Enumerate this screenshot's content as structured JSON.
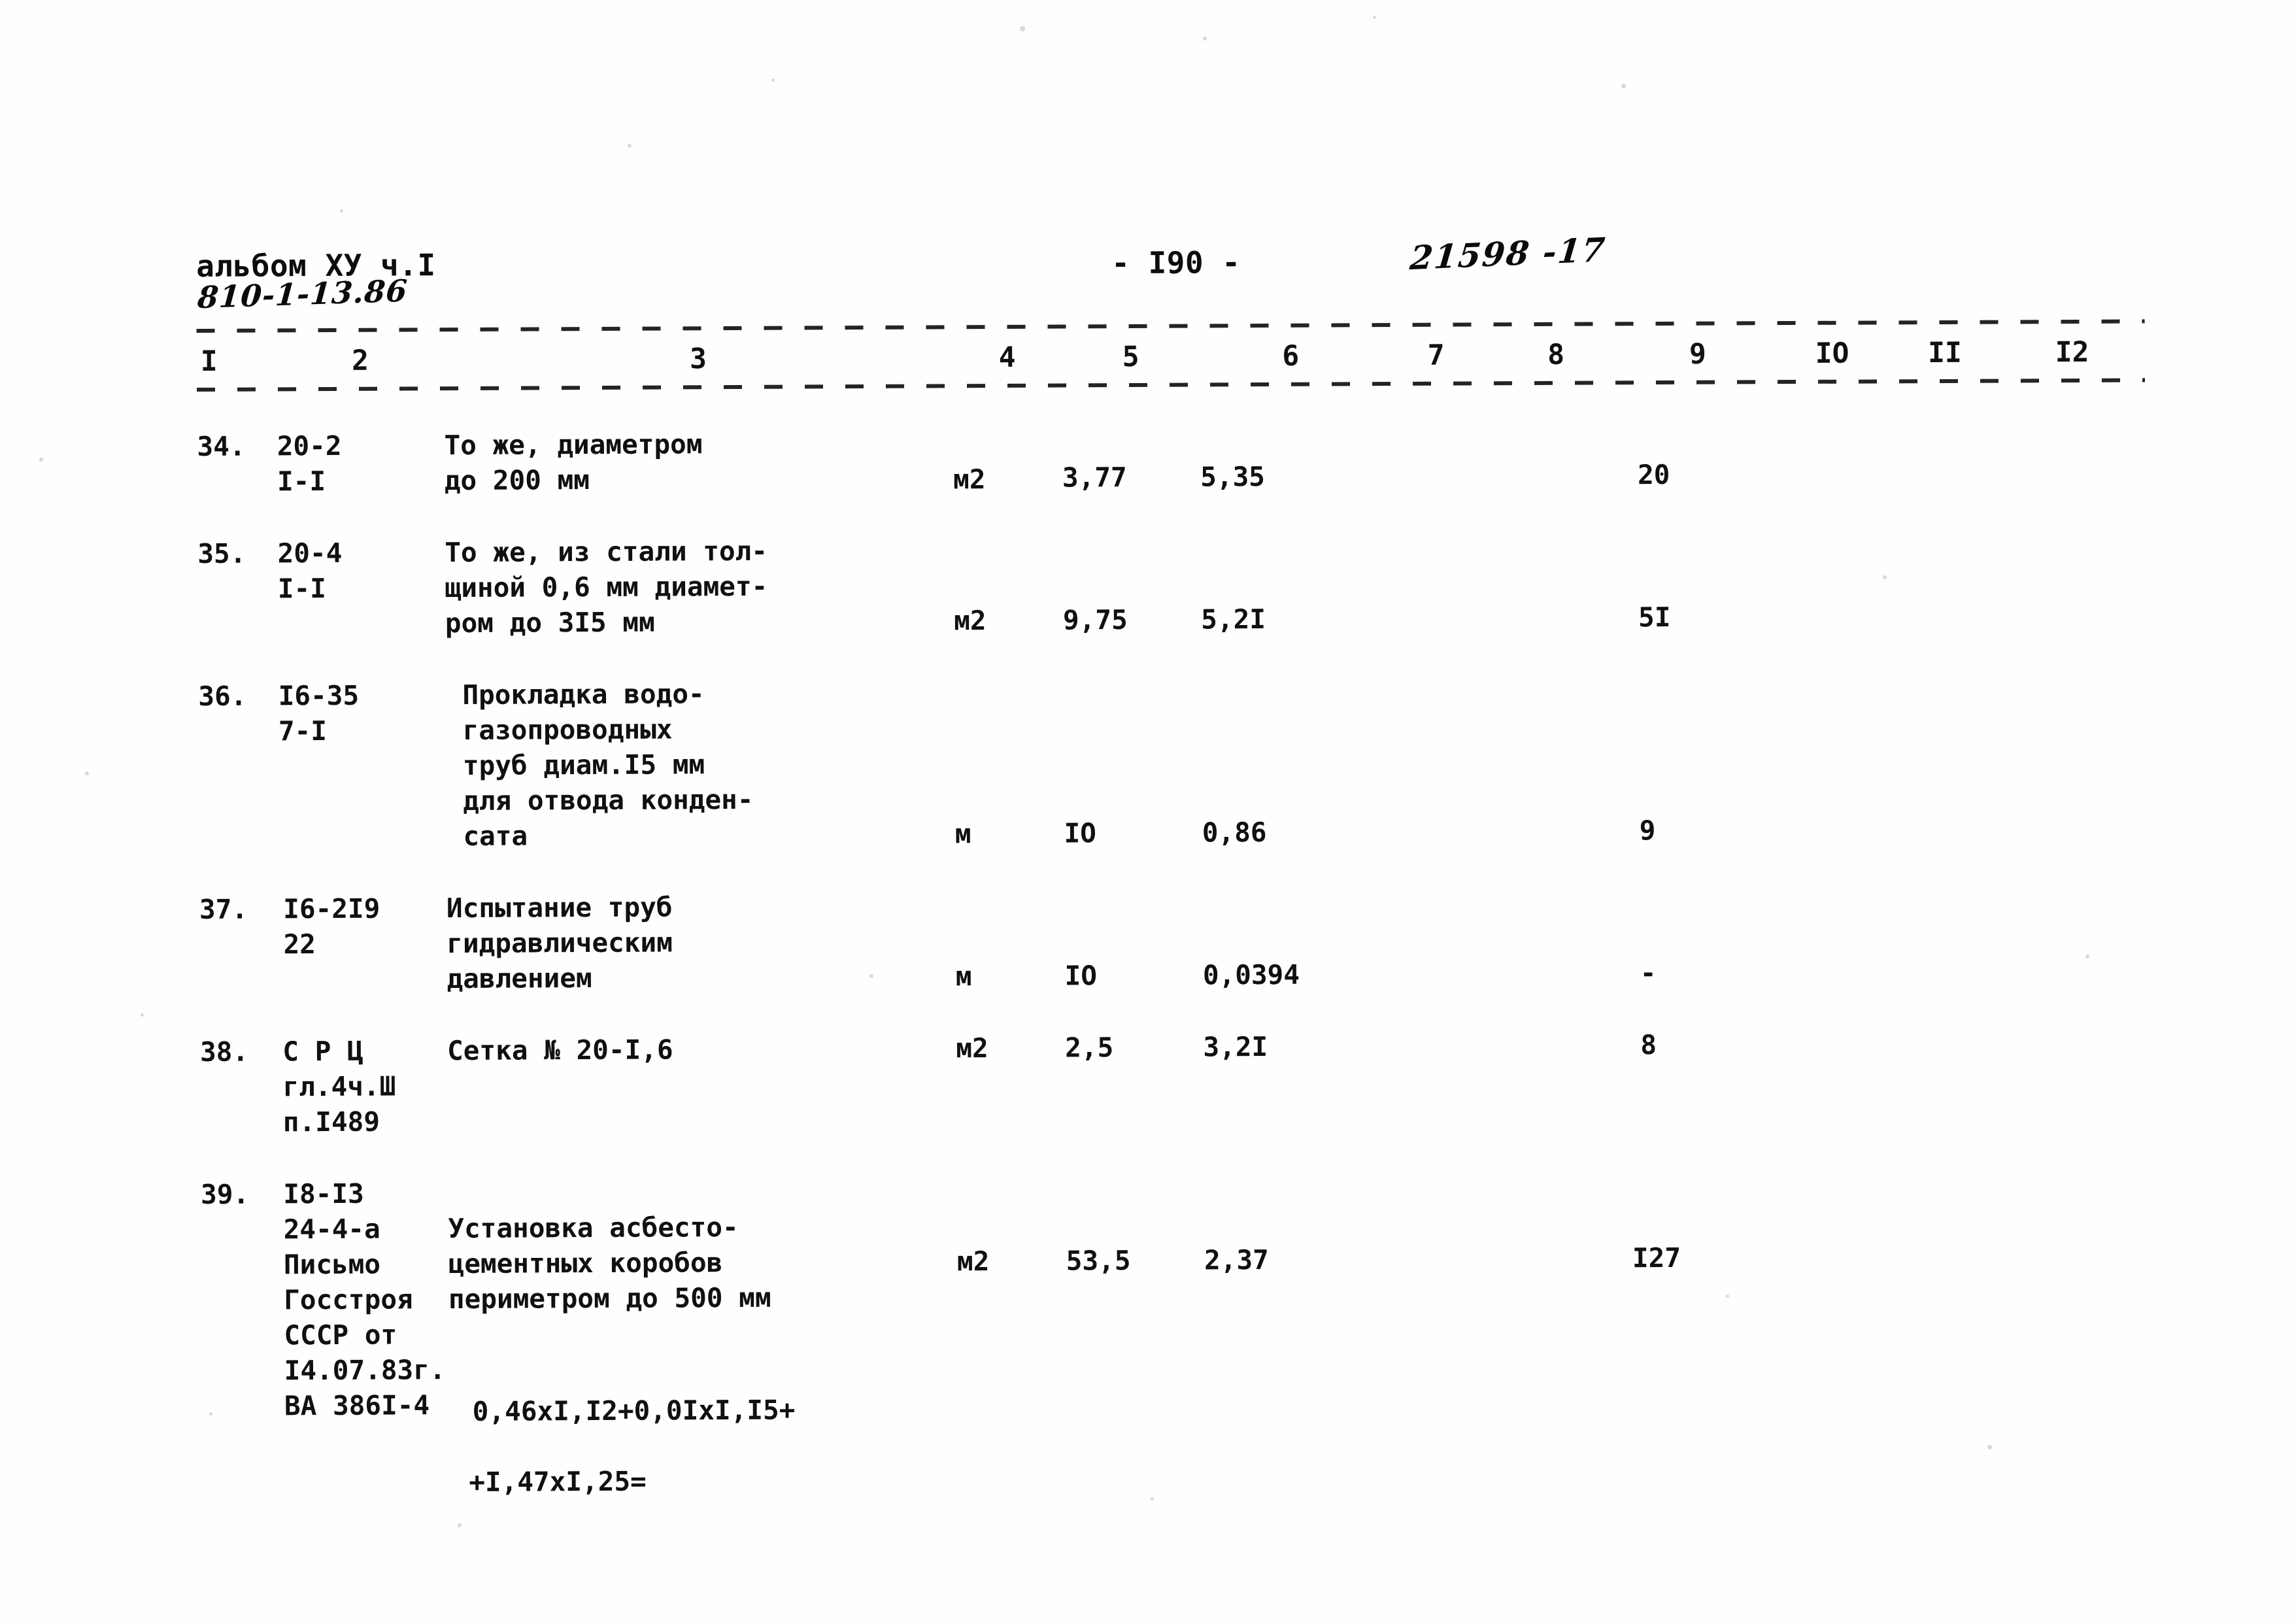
{
  "document": {
    "header": {
      "album_label": "альбом ХУ ч.I",
      "project_code": "810-1-13.86",
      "page_number": "- I90 -",
      "doc_number": "21598 -17"
    },
    "column_headers": [
      "I",
      "2",
      "3",
      "4",
      "5",
      "6",
      "7",
      "8",
      "9",
      "IO",
      "II",
      "I2"
    ],
    "rows": [
      {
        "index": "34.",
        "code": "20-2\nI-I",
        "description": "То же, диаметром\nдо 200 мм",
        "unit": "м2",
        "col5": "3,77",
        "col6": "5,35",
        "col7": "",
        "col8": "",
        "col9": "20",
        "col10": "",
        "col11": "",
        "col12": ""
      },
      {
        "index": "35.",
        "code": "20-4\nI-I",
        "description": "То же, из стали тол-\nщиной 0,6 мм диамет-\nром до 3I5 мм",
        "unit": "м2",
        "col5": "9,75",
        "col6": "5,2I",
        "col7": "",
        "col8": "",
        "col9": "5I",
        "col10": "",
        "col11": "",
        "col12": ""
      },
      {
        "index": "36.",
        "code": "I6-35\n7-I",
        "description": "Прокладка водо-\nгазопроводных\nтруб диам.I5  мм\nдля отвода конден-\nсата",
        "unit": "м",
        "col5": "IO",
        "col6": "0,86",
        "col7": "",
        "col8": "",
        "col9": "9",
        "col10": "",
        "col11": "",
        "col12": ""
      },
      {
        "index": "37.",
        "code": "I6-2I9\n22",
        "description": "Испытание труб\nгидравлическим\nдавлением",
        "unit": "м",
        "col5": "IO",
        "col6": "0,0394",
        "col7": "",
        "col8": "",
        "col9": "-",
        "col10": "",
        "col11": "",
        "col12": ""
      },
      {
        "index": "38.",
        "code": "С Р Ц\nгл.4ч.Ш\nп.I489",
        "description": "Сетка № 20-I,6",
        "unit": "м2",
        "col5": "2,5",
        "col6": "3,2I",
        "col7": "",
        "col8": "",
        "col9": "8",
        "col10": "",
        "col11": "",
        "col12": ""
      },
      {
        "index": "39.",
        "code": "I8-I3\n24-4-а\nПисьмо\nГосстроя\nСССР от\nI4.07.83г.\nВА 386I-4",
        "description": "Установка асбесто-\nцементных коробов\nпериметром до 500 мм",
        "unit": "м2",
        "col5": "53,5",
        "col6": "2,37",
        "col7": "",
        "col8": "",
        "col9": "I27",
        "col10": "",
        "col11": "",
        "col12": "",
        "formula_line_1": "0,46xI,I2+0,0IxI,I5+",
        "formula_line_2": "+I,47xI,25="
      }
    ]
  }
}
